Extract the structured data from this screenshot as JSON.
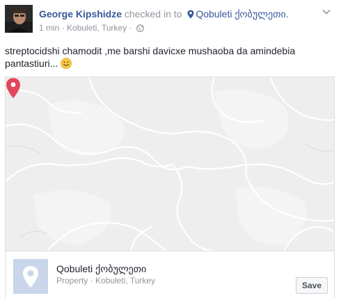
{
  "post": {
    "author": "George Kipshidze",
    "action_text": "checked in to",
    "place": "Qobuleti ქობულეთი.",
    "time": "1 min",
    "separator": "·",
    "location": "Kobuleti, Turkey",
    "body": "streptocidshi chamodit ,me barshi davicxe mushaoba da amindebia pantastiuri..."
  },
  "place_card": {
    "name": "Qobuleti ქობულეთი",
    "category": "Property",
    "separator": "·",
    "location": "Kobuleti, Turkey",
    "save_label": "Save"
  },
  "icons": {
    "location": "map-pin-icon",
    "audience": "globe-icon",
    "options": "chevron-down-icon",
    "emoji": "smiley-emoji-icon",
    "map_marker": "map-marker-icon",
    "place_thumb": "place-pin-icon"
  },
  "colors": {
    "link": "#365899",
    "meta": "#90949c",
    "marker": "#e3465a",
    "map_bg": "#eeeeee"
  }
}
